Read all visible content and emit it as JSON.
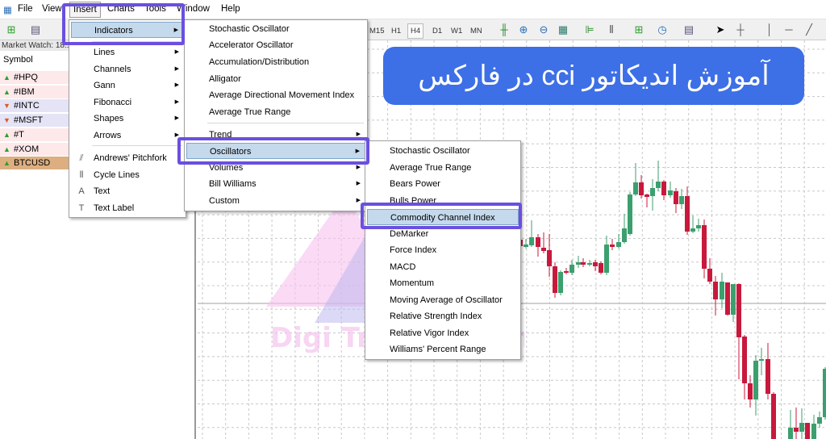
{
  "menubar": {
    "items": [
      "File",
      "View",
      "Insert",
      "Charts",
      "Tools",
      "Window",
      "Help"
    ],
    "active": "Insert"
  },
  "toolbar": {
    "timeframes": [
      "M15",
      "H1",
      "H4",
      "D1",
      "W1",
      "MN"
    ],
    "active_timeframe": "H4"
  },
  "market_watch": {
    "title": "Market Watch: 18:1",
    "column": "Symbol",
    "rows": [
      {
        "symbol": "#HPQ",
        "direction": "up",
        "bg": "#fde8ea"
      },
      {
        "symbol": "#IBM",
        "direction": "up",
        "bg": "#fde8ea"
      },
      {
        "symbol": "#INTC",
        "direction": "down",
        "bg": "#e4e4f6"
      },
      {
        "symbol": "#MSFT",
        "direction": "down",
        "bg": "#e4e4f6"
      },
      {
        "symbol": "#T",
        "direction": "up",
        "bg": "#fde8ea"
      },
      {
        "symbol": "#XOM",
        "direction": "up",
        "bg": "#fde8ea"
      },
      {
        "symbol": "BTCUSD",
        "direction": "up",
        "bg": "#dcae80"
      }
    ]
  },
  "insert_menu": {
    "items": [
      "Indicators",
      "Lines",
      "Channels",
      "Gann",
      "Fibonacci",
      "Shapes",
      "Arrows",
      "Andrews' Pitchfork",
      "Cycle Lines",
      "Text",
      "Text Label"
    ],
    "highlighted": "Indicators"
  },
  "indicators_menu": {
    "items": [
      "Stochastic Oscillator",
      "Accelerator Oscillator",
      "Accumulation/Distribution",
      "Alligator",
      "Average Directional Movement Index",
      "Average True Range",
      "Trend",
      "Oscillators",
      "Volumes",
      "Bill Williams",
      "Custom"
    ],
    "highlighted": "Oscillators"
  },
  "oscillators_menu": {
    "items": [
      "Stochastic Oscillator",
      "Average True Range",
      "Bears Power",
      "Bulls Power",
      "Commodity Channel Index",
      "DeMarker",
      "Force Index",
      "MACD",
      "Momentum",
      "Moving Average of Oscillator",
      "Relative Strength Index",
      "Relative Vigor Index",
      "Williams' Percent Range"
    ],
    "highlighted": "Commodity Channel Index"
  },
  "banner": {
    "text": "آموزش اندیکاتور cci در فارکس",
    "color": "#3d6fe6"
  },
  "watermark": {
    "text": "DigiTraderz.com"
  },
  "colors": {
    "bull": "#3c9f6e",
    "bear": "#c8193c",
    "highlight_box": "#6b4fe0"
  }
}
